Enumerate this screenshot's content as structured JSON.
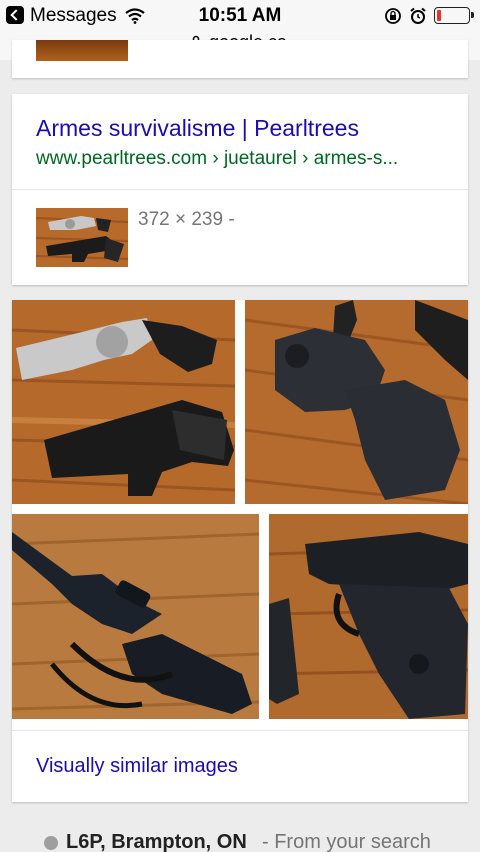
{
  "status_bar": {
    "back_app": "Messages",
    "time": "10:51 AM",
    "battery_level": 0.15,
    "battery_color": "#e33333"
  },
  "url_bar": {
    "domain": "google.ca"
  },
  "result": {
    "title": "Armes survivalisme | Pearltrees",
    "url": "www.pearltrees.com › juetaurel › armes-s...",
    "dimensions": "372 × 239 -"
  },
  "similar_images": {
    "link": "Visually similar images"
  },
  "location": {
    "place": "L6P, Brampton, ON",
    "suffix": "- From your search"
  },
  "colors": {
    "link": "#1a0dab",
    "url": "#006621",
    "wood": "#b86a2a"
  }
}
